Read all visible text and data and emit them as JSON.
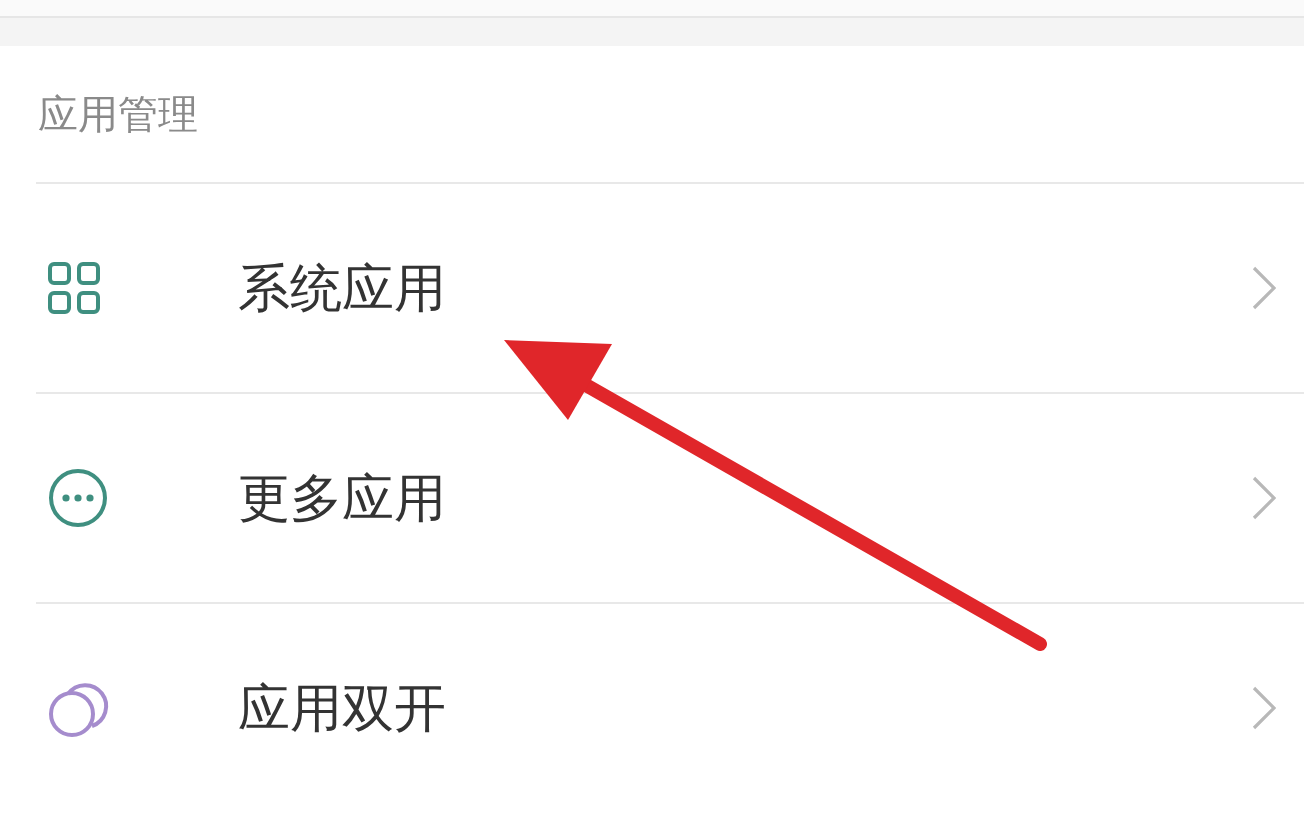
{
  "section": {
    "title": "应用管理"
  },
  "items": [
    {
      "label": "系统应用",
      "kind": "grid"
    },
    {
      "label": "更多应用",
      "kind": "dots"
    },
    {
      "label": "应用双开",
      "kind": "rings"
    }
  ],
  "annotation": {
    "kind": "arrow"
  }
}
